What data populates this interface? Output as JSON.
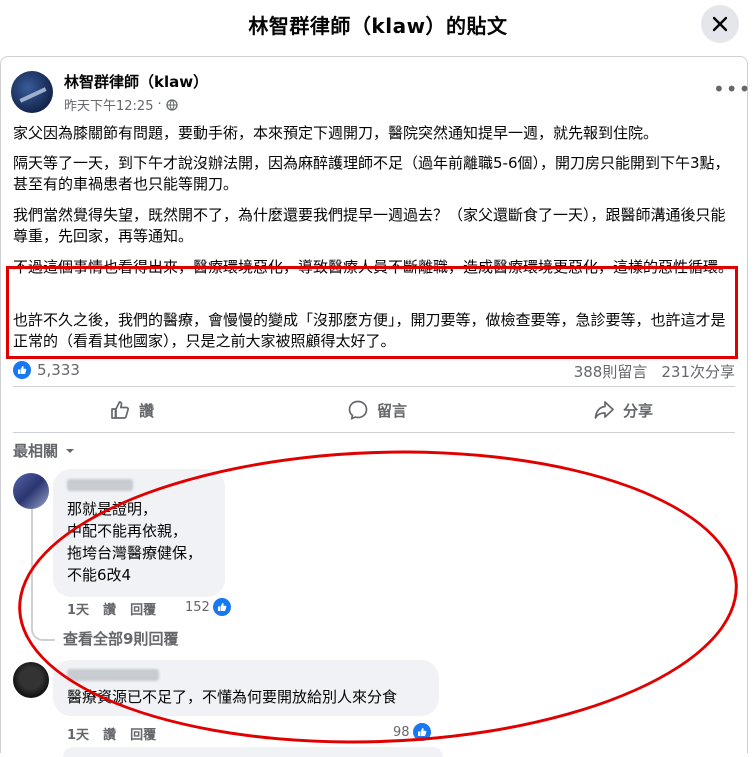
{
  "header": {
    "title": "林智群律師（klaw）的貼文",
    "close_icon": "close-icon"
  },
  "post": {
    "author": "林智群律師（klaw）",
    "time": "昨天下午12:25",
    "privacy_icon": "globe-icon",
    "more_icon": "more-options-icon",
    "paragraphs": [
      "家父因為膝關節有問題，要動手術，本來預定下週開刀，醫院突然通知提早一週，就先報到住院。",
      "隔天等了一天，到下午才說沒辦法開，因為麻醉護理師不足（過年前離職5-6個），開刀房只能開到下午3點，甚至有的車禍患者也只能等開刀。",
      "我們當然覺得失望，既然開不了，為什麼還要我們提早一週過去？（家父還斷食了一天），跟醫師溝通後只能尊重，先回家，再等通知。",
      "不過這個事情也看得出來，醫療環境惡化，導致醫療人員不斷離職，造成醫療環境更惡化，這樣的惡性循環。",
      "也許不久之後，我們的醫療，會慢慢的變成「沒那麼方便」，開刀要等，做檢查要等，急診要等，也許這才是正常的（看看其他國家），只是之前大家被照顧得太好了。"
    ],
    "reactions": "5,333",
    "comments_count": "388則留言",
    "shares_count": "231次分享"
  },
  "actions": {
    "like": "讚",
    "comment": "留言",
    "share": "分享"
  },
  "sort": {
    "label": "最相關"
  },
  "comments": [
    {
      "lines": [
        "那就是證明，",
        "中配不能再依親，",
        "拖垮台灣醫療健保，",
        "不能6改4"
      ],
      "time": "1天",
      "like": "讚",
      "reply": "回覆",
      "reactions": "152"
    },
    {
      "lines": [
        "醫療資源已不足了，不懂為何要開放給別人來分食"
      ],
      "time": "1天",
      "like": "讚",
      "reply": "回覆",
      "reactions": "98"
    }
  ],
  "view_replies": "查看全部9則回覆",
  "colors": {
    "accent": "#1877f2",
    "highlight": "#e10000",
    "muted": "#65676b",
    "bubble": "#f0f2f5"
  }
}
